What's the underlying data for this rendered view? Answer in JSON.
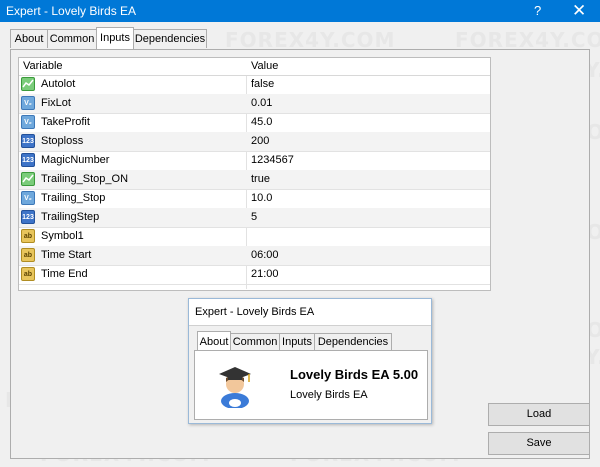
{
  "window": {
    "title": "Expert - Lovely Birds EA",
    "help": "?",
    "close": "✕"
  },
  "tabs": [
    "About",
    "Common",
    "Inputs",
    "Dependencies"
  ],
  "active_tab": "Inputs",
  "grid": {
    "headers": {
      "variable": "Variable",
      "value": "Value"
    },
    "rows": [
      {
        "icon": "bool-type-icon",
        "name": "Autolot",
        "value": "false"
      },
      {
        "icon": "double-type-icon",
        "name": "FixLot",
        "value": "0.01"
      },
      {
        "icon": "double-type-icon",
        "name": "TakeProfit",
        "value": "45.0"
      },
      {
        "icon": "int-type-icon",
        "name": "Stoploss",
        "value": "200"
      },
      {
        "icon": "int-type-icon",
        "name": "MagicNumber",
        "value": "1234567"
      },
      {
        "icon": "bool-type-icon",
        "name": "Trailing_Stop_ON",
        "value": "true"
      },
      {
        "icon": "double-type-icon",
        "name": "Trailing_Stop",
        "value": "10.0"
      },
      {
        "icon": "int-type-icon",
        "name": "TrailingStep",
        "value": "5"
      },
      {
        "icon": "string-type-icon",
        "name": "Symbol1",
        "value": ""
      },
      {
        "icon": "string-type-icon",
        "name": "Time Start",
        "value": "06:00"
      },
      {
        "icon": "string-type-icon",
        "name": "Time End",
        "value": "21:00"
      }
    ]
  },
  "buttons": {
    "load": "Load",
    "save": "Save"
  },
  "about_popup": {
    "title": "Expert - Lovely Birds EA",
    "tabs": [
      "About",
      "Common",
      "Inputs",
      "Dependencies"
    ],
    "active_tab": "About",
    "product_name": "Lovely Birds EA 5.00",
    "product_sub": "Lovely Birds EA"
  },
  "watermarks": [
    "FOREX4S.NET",
    "FOREX4Y.COM"
  ],
  "colors": {
    "titlebar": "#0078d7",
    "bool_icon": "#7acc7a",
    "double_icon": "#6fa8dc",
    "int_icon": "#3e74c8",
    "string_icon": "#e8c55c"
  }
}
